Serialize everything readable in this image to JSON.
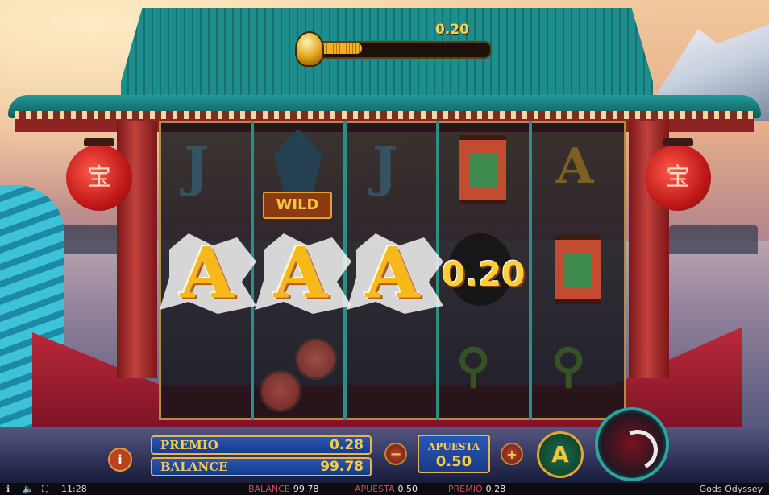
{
  "game": {
    "title": "Gods Odyssey",
    "clock": "11:28"
  },
  "multiplier": {
    "value": "0.20",
    "fill_fraction": 0.3
  },
  "reels": {
    "columns": [
      [
        "J",
        "A",
        ""
      ],
      [
        "WILD",
        "A",
        "coin"
      ],
      [
        "J",
        "A",
        ""
      ],
      [
        "scroll",
        "0.20",
        "key"
      ],
      [
        "A",
        "scroll",
        "key"
      ]
    ],
    "wild_label": "WILD",
    "win_amount": "0.20",
    "dim_j": "J",
    "dim_a": "A",
    "win_a": "A"
  },
  "hud": {
    "info_label": "i",
    "premio_label": "PREMIO",
    "premio_value": "0.28",
    "balance_label": "BALANCE",
    "balance_value": "99.78",
    "minus_label": "−",
    "plus_label": "+",
    "apuesta_label": "APUESTA",
    "apuesta_value": "0.50",
    "auto_label": "A"
  },
  "status_bar": {
    "balance_label": "BALANCE",
    "balance_value": "99.78",
    "apuesta_label": "APUESTA",
    "apuesta_value": "0.50",
    "premio_label": "PREMIO",
    "premio_value": "0.28",
    "info_icon": "ℹ",
    "sound_icon": "🔈",
    "fullscreen_icon": "⛶"
  },
  "colors": {
    "gold": "#f5cb4a",
    "panel_blue": "#1f4aa0",
    "status_red": "#c94d63"
  }
}
